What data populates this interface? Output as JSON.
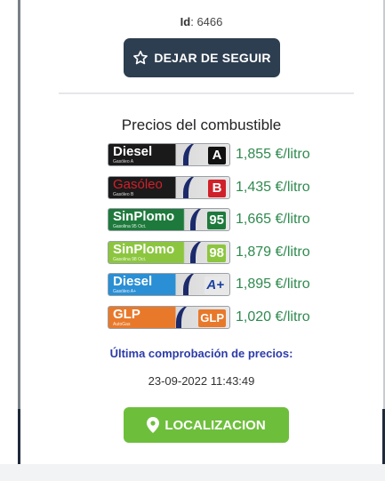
{
  "station": {
    "id_label": "Id",
    "id_value": "6466"
  },
  "unfollow_button": {
    "label": "DEJAR DE SEGUIR",
    "icon": "star-outline-icon"
  },
  "prices": {
    "title": "Precios del combustible",
    "items": [
      {
        "name": "Diesel",
        "sub": "Gasóleo A",
        "letter": "A",
        "price": "1,855 €/litro"
      },
      {
        "name": "Gasóleo",
        "sub": "Gasóleo B",
        "letter": "B",
        "price": "1,435 €/litro"
      },
      {
        "name": "SinPlomo",
        "sub": "Gasolina 95 Oct.",
        "letter": "95",
        "price": "1,665 €/litro"
      },
      {
        "name": "SinPlomo",
        "sub": "Gasolina 98 Oct.",
        "letter": "98",
        "price": "1,879 €/litro"
      },
      {
        "name": "Diesel",
        "sub": "Gasóleo A+",
        "letter": "A+",
        "price": "1,895 €/litro"
      },
      {
        "name": "GLP",
        "sub": "AutoGas",
        "letter": "GLP",
        "price": "1,020 €/litro"
      }
    ]
  },
  "last_check": {
    "label": "Última comprobación de precios:",
    "datetime": "23-09-2022 11:43:49"
  },
  "locate_button": {
    "label": "LOCALIZACION",
    "icon": "map-marker-icon"
  },
  "colors": {
    "primary_button": "#2d3e50",
    "locate_button": "#6dbf3b",
    "price_text": "#2f8a4f",
    "link_text": "#2c3ca8"
  }
}
